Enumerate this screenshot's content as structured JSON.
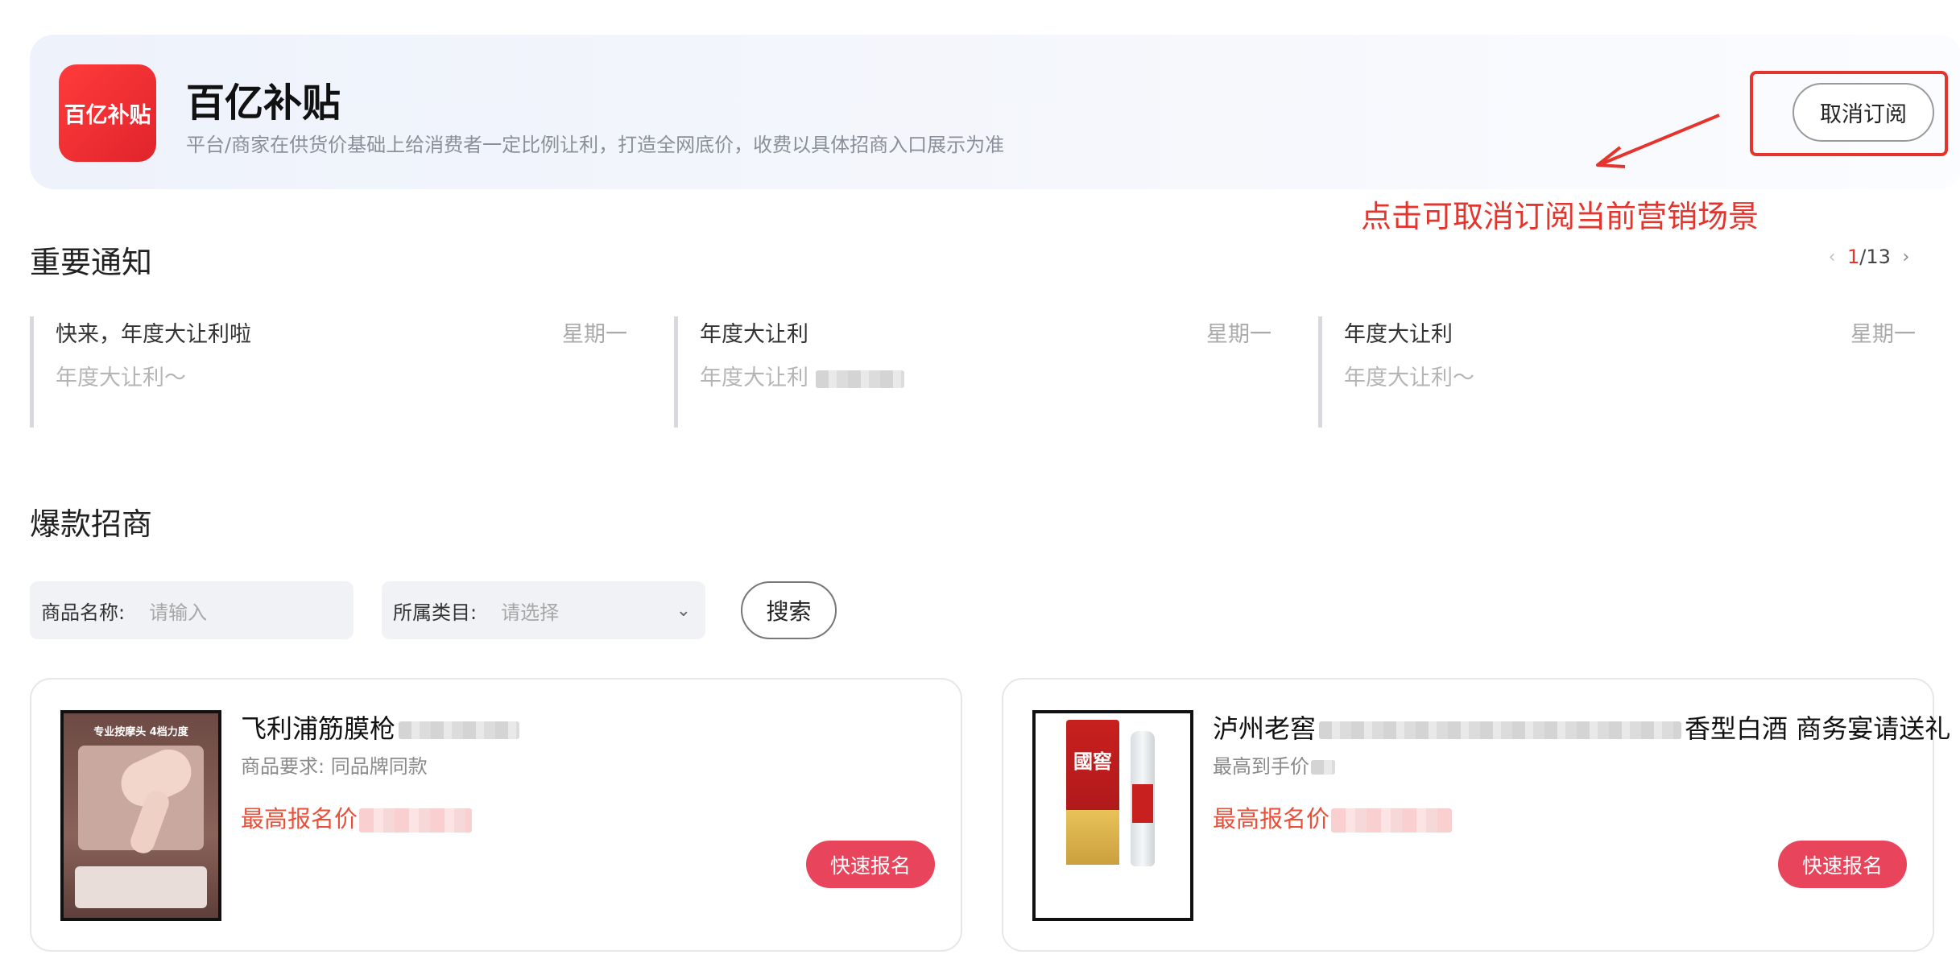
{
  "header": {
    "logo_text": "百亿补贴",
    "title": "百亿补贴",
    "subtitle": "平台/商家在供货价基础上给消费者一定比例让利，打造全网底价，收费以具体招商入口展示为准",
    "cancel_button": "取消订阅"
  },
  "annotation": {
    "text": "点击可取消订阅当前营销场景",
    "color": "#e3352e"
  },
  "notices": {
    "section_title": "重要通知",
    "pager": {
      "current": "1",
      "total": "/13"
    },
    "items": [
      {
        "title": "快来，年度大让利啦",
        "date": "星期一",
        "body": "年度大让利～"
      },
      {
        "title": "年度大让利",
        "date": "星期一",
        "body": "年度大让利"
      },
      {
        "title": "年度大让利",
        "date": "星期一",
        "body": "年度大让利～"
      }
    ]
  },
  "hot": {
    "section_title": "爆款招商",
    "filters": {
      "name_label": "商品名称:",
      "name_placeholder": "请输入",
      "category_label": "所属类目:",
      "category_placeholder": "请选择",
      "search_button": "搜索"
    },
    "products": [
      {
        "name": "飞利浦筋膜枪",
        "requirement": "商品要求: 同品牌同款",
        "price_label": "最高报名价",
        "button": "快速报名",
        "thumb": {
          "headline": "专业按摩头 4档力度",
          "icon": "massage-gun-image"
        }
      },
      {
        "name": "泸州老窖",
        "name_tail": "香型白酒 商务宴请送礼",
        "requirement": "最高到手价",
        "price_label": "最高报名价",
        "button": "快速报名",
        "thumb": {
          "brand": "國窖",
          "icon": "liquor-bottle-image"
        }
      }
    ]
  },
  "colors": {
    "accent_red": "#e3352e",
    "button_pink": "#e8455c",
    "price_orange": "#e8503a"
  }
}
